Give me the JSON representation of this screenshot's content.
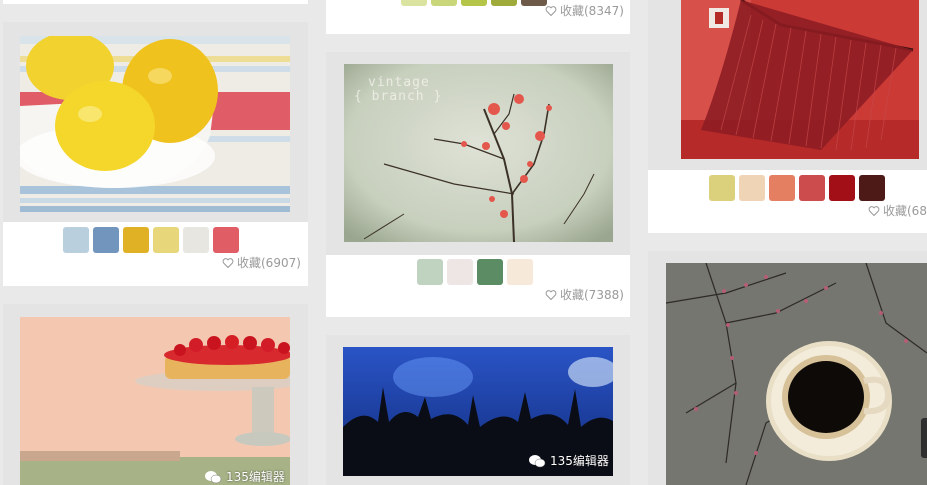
{
  "columns": [
    {
      "cards": [
        {
          "id": "lemons",
          "palette": [
            "#b9cfdd",
            "#7195bd",
            "#e0b125",
            "#e8d67a",
            "#e8e6e0",
            "#e05d65"
          ],
          "favorites_label": "收藏(6907)"
        },
        {
          "id": "tart",
          "watermark": "135编辑器"
        }
      ]
    },
    {
      "cards": [
        {
          "id": "top-partial",
          "palette": [
            "#dbe3a0",
            "#c9d77a",
            "#b5c548",
            "#9eaa3a",
            "#6e5a48"
          ],
          "favorites_label": "收藏(8347)"
        },
        {
          "id": "vintage-branch",
          "image_text": [
            "vintage",
            "{ branch }"
          ],
          "palette": [
            "#bfd3c0",
            "#ede6e4",
            "#5b8c63",
            "#f6e9da"
          ],
          "favorites_label": "收藏(7388)"
        },
        {
          "id": "concert",
          "watermark": "135编辑器"
        }
      ]
    },
    {
      "cards": [
        {
          "id": "hammock",
          "palette": [
            "#dbd07c",
            "#f0d4b6",
            "#e47f62",
            "#cc4b4d",
            "#a30f17",
            "#4d1a17"
          ],
          "favorites_label": "收藏(68"
        },
        {
          "id": "coffee"
        }
      ]
    }
  ],
  "icons": {
    "favorite": "heart-outline-icon",
    "watermark": "wechat-icon"
  }
}
